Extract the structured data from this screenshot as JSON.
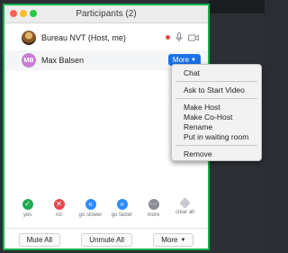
{
  "window": {
    "title": "Participants (2)"
  },
  "participants": [
    {
      "name": "Bureau NVT (Host, me)",
      "avatar": "photo"
    },
    {
      "name": "Max Balsen",
      "initials": "MB",
      "more_label": "More"
    }
  ],
  "menu": {
    "items": [
      "Chat",
      "Ask to Start Video",
      "Make Host",
      "Make Co-Host",
      "Rename",
      "Put in waiting room",
      "Remove"
    ]
  },
  "reactions": [
    {
      "label": "yes",
      "icon": "check-icon",
      "glyph": "✓"
    },
    {
      "label": "no",
      "icon": "x-icon",
      "glyph": "✕"
    },
    {
      "label": "go slower",
      "icon": "rewind-icon",
      "glyph": "«"
    },
    {
      "label": "go faster",
      "icon": "fast-forward-icon",
      "glyph": "»"
    },
    {
      "label": "more",
      "icon": "ellipsis-icon",
      "glyph": "⋯"
    },
    {
      "label": "clear all",
      "icon": "diamond-icon",
      "glyph": ""
    }
  ],
  "bottom": {
    "mute_all": "Mute All",
    "unmute_all": "Unmute All",
    "more": "More"
  },
  "colors": {
    "window_border": "#14b04a",
    "more_button": "#1a73e8",
    "avatar_mb": "#c77dd4"
  }
}
